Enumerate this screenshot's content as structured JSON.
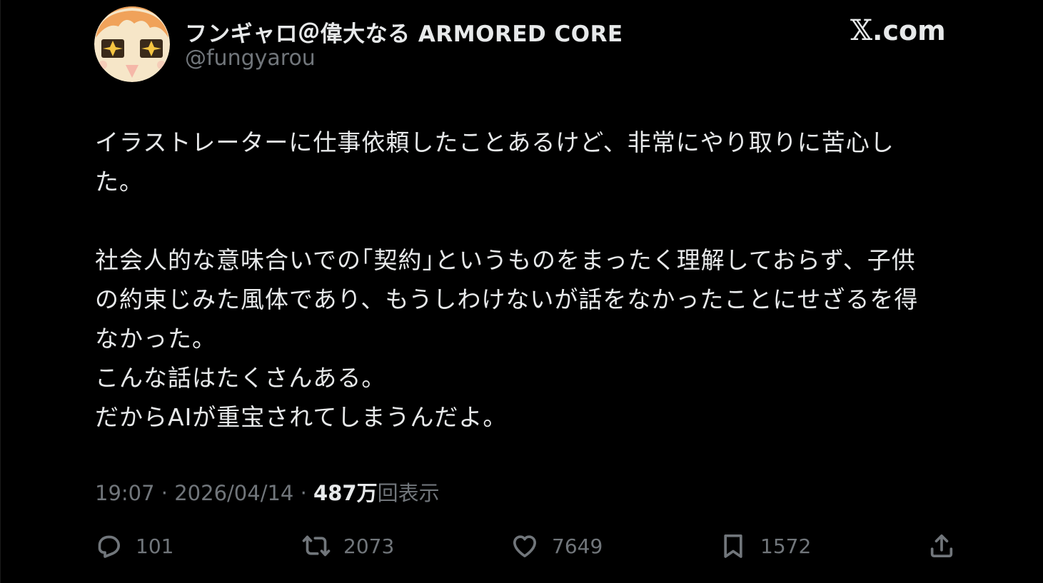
{
  "author": {
    "display_name": "フンギャロ＠偉大なる ARMORED CORE",
    "handle": "@fungyarou"
  },
  "brand": {
    "x_glyph": "𝕏",
    "domain_suffix": ".com"
  },
  "tweet": {
    "paragraph1_line1": "イラストレーターに仕事依頼したことあるけど、非常にやり取りに苦心し",
    "paragraph1_line2": "た。",
    "paragraph2_line1": "社会人的な意味合いでの｢契約｣というものをまったく理解しておらず、子供",
    "paragraph2_line2": "の約束じみた風体であり、もうしわけないが話をなかったことにせざるを得",
    "paragraph2_line3": "なかった。",
    "paragraph2_line4": "こんな話はたくさんある。",
    "paragraph2_line5": "だからAIが重宝されてしまうんだよ。"
  },
  "meta": {
    "time": "19:07",
    "separator": "·",
    "date": "2026/04/14",
    "views_count": "487万",
    "views_label": "回表示"
  },
  "actions": {
    "reply_count": "101",
    "retweet_count": "2073",
    "like_count": "7649",
    "bookmark_count": "1572"
  },
  "icons": {
    "reply": "reply-icon",
    "retweet": "retweet-icon",
    "like": "heart-icon",
    "bookmark": "bookmark-icon",
    "share": "share-icon"
  },
  "colors": {
    "background": "#000000",
    "text": "#e7e9ea",
    "secondary": "#71767b",
    "avatar_bg": "#f6e6c8",
    "avatar_hair": "#f0a25a"
  }
}
